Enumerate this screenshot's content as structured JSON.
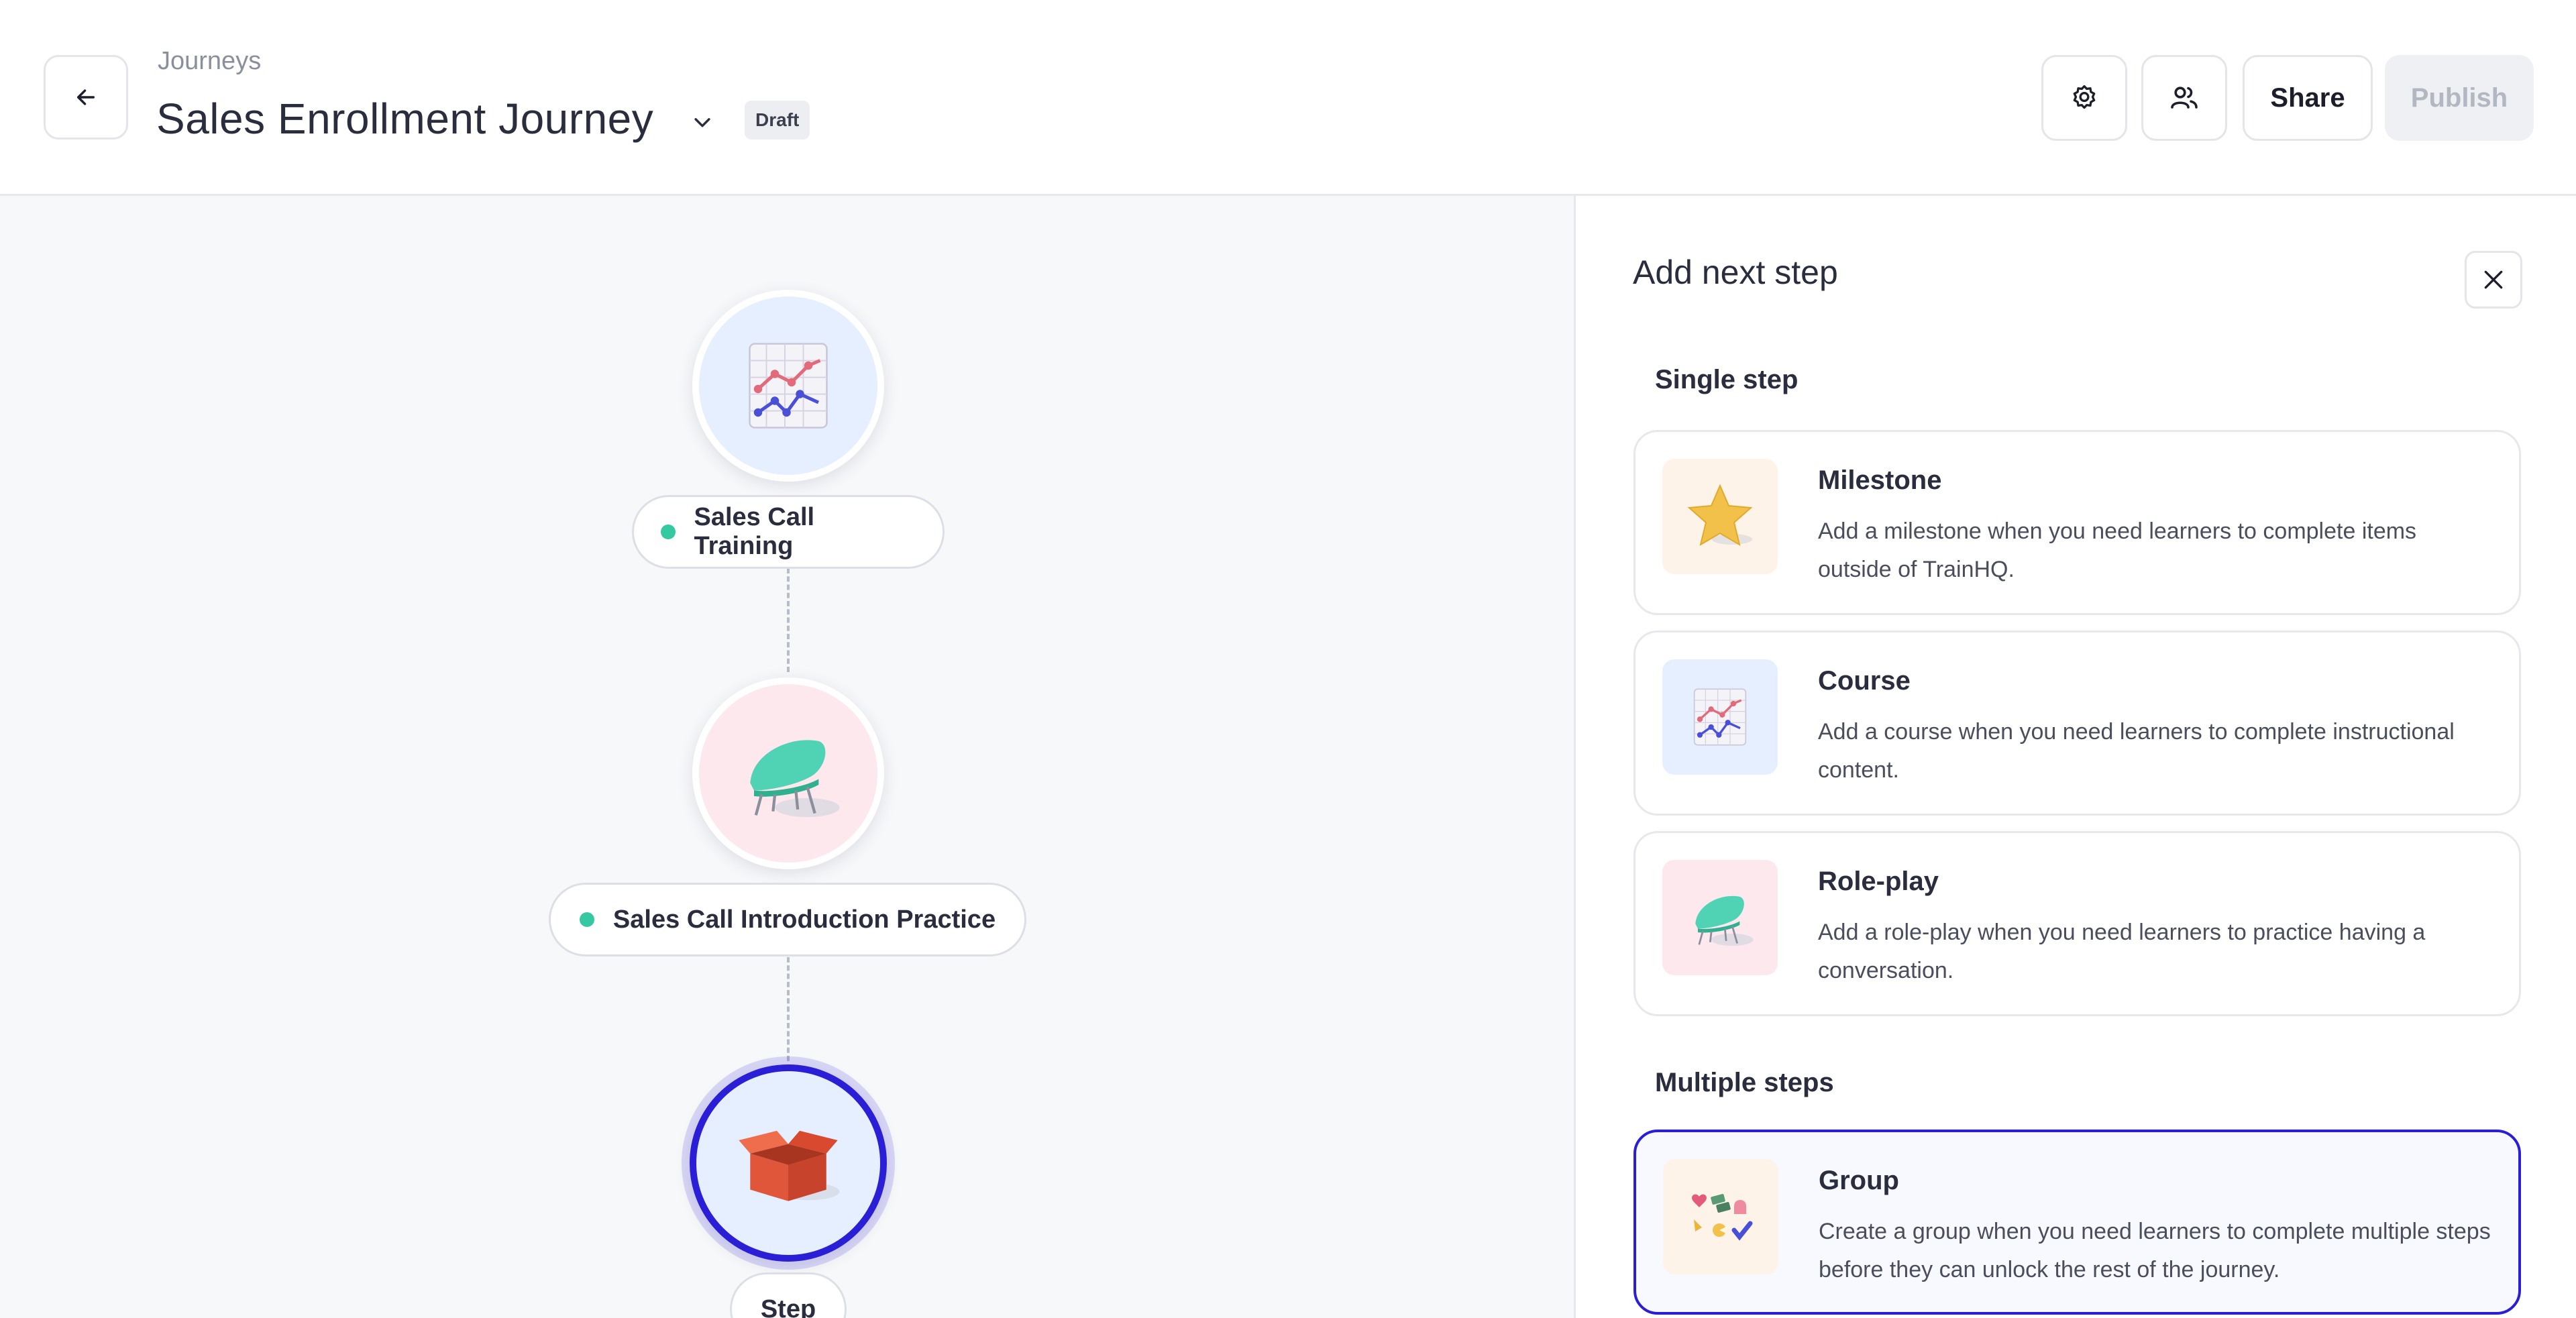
{
  "header": {
    "breadcrumb": "Journeys",
    "title": "Sales Enrollment Journey",
    "status_badge": "Draft",
    "share_label": "Share",
    "publish_label": "Publish",
    "icons": [
      "arrow-left-icon",
      "chevron-down-icon",
      "gear-icon",
      "users-icon"
    ]
  },
  "canvas": {
    "nodes": [
      {
        "label": "Sales Call Training",
        "icon": "chart-icon",
        "status_color": "#35c9a1"
      },
      {
        "label": "Sales Call Introduction Practice",
        "icon": "chair-icon",
        "status_color": "#35c9a1"
      },
      {
        "label": "Step",
        "icon": "box-icon"
      }
    ]
  },
  "panel": {
    "title": "Add next step",
    "single_section": "Single step",
    "multiple_section": "Multiple steps",
    "options": [
      {
        "name": "Milestone",
        "description": "Add a milestone when you need learners to complete items outside of TrainHQ.",
        "icon": "star-icon"
      },
      {
        "name": "Course",
        "description": "Add a course when you need learners to complete instructional content.",
        "icon": "chart-icon"
      },
      {
        "name": "Role-play",
        "description": "Add a role-play when you need learners to practice having a conversation.",
        "icon": "chair-icon"
      },
      {
        "name": "Group",
        "description": "Create a group when you need learners to complete multiple steps before they can unlock the rest of the journey.",
        "icon": "group-icon"
      }
    ]
  },
  "colors": {
    "accent": "#2a1fd6",
    "status_green": "#35c9a1",
    "canvas_bg": "#f7f8fa"
  }
}
